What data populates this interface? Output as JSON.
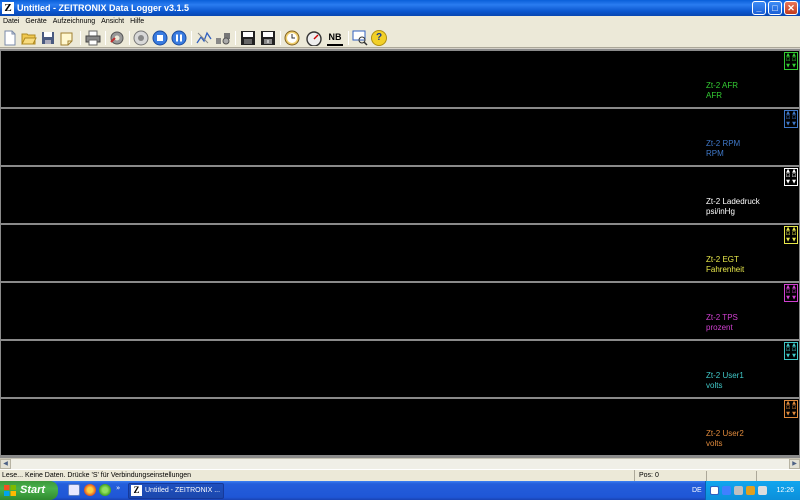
{
  "window": {
    "title": "Untitled - ZEITRONIX Data Logger v3.1.5",
    "app_icon": "Z",
    "buttons": {
      "minimize": "_",
      "maximize": "□",
      "close": "✕"
    }
  },
  "menu": [
    "Datei",
    "Geräte",
    "Aufzeichnung",
    "Ansicht",
    "Hilfe"
  ],
  "toolbar_icons": [
    "new-file-icon",
    "open-folder-icon",
    "save-icon",
    "note-icon",
    "print-icon",
    "settings-gear-icon",
    "record-icon",
    "stop-icon",
    "pause-icon",
    "chart-edit-icon",
    "analyze-icon",
    "save-data-icon",
    "export-icon",
    "clock-icon",
    "gauge-icon",
    "nb-icon",
    "search-icon",
    "help-icon"
  ],
  "nb_label": "NB",
  "help_label": "?",
  "channels": [
    {
      "name": "Zt-2 AFR",
      "unit": "AFR",
      "color": "#33cc33"
    },
    {
      "name": "Zt-2 RPM",
      "unit": "RPM",
      "color": "#3f78c8"
    },
    {
      "name": "Zt-2 Ladedruck",
      "unit": "psi/inHg",
      "color": "#ffffff"
    },
    {
      "name": "Zt-2 EGT",
      "unit": "Fahrenheit",
      "color": "#e8e84a"
    },
    {
      "name": "Zt-2 TPS",
      "unit": "prozent",
      "color": "#d040d0"
    },
    {
      "name": "Zt-2 User1",
      "unit": "volts",
      "color": "#40c8c8"
    },
    {
      "name": "Zt-2 User2",
      "unit": "volts",
      "color": "#e08a3c"
    }
  ],
  "status": {
    "message": "Lese...  Keine Daten.  Drücke 'S' für Verbindungseinstellungen",
    "position": "Pos: 0"
  },
  "taskbar": {
    "start_label": "Start",
    "task_label": "Untitled - ZEITRONIX ...",
    "task_icon": "Z",
    "expand_label": "»",
    "language": "DE",
    "clock": "12:26"
  }
}
